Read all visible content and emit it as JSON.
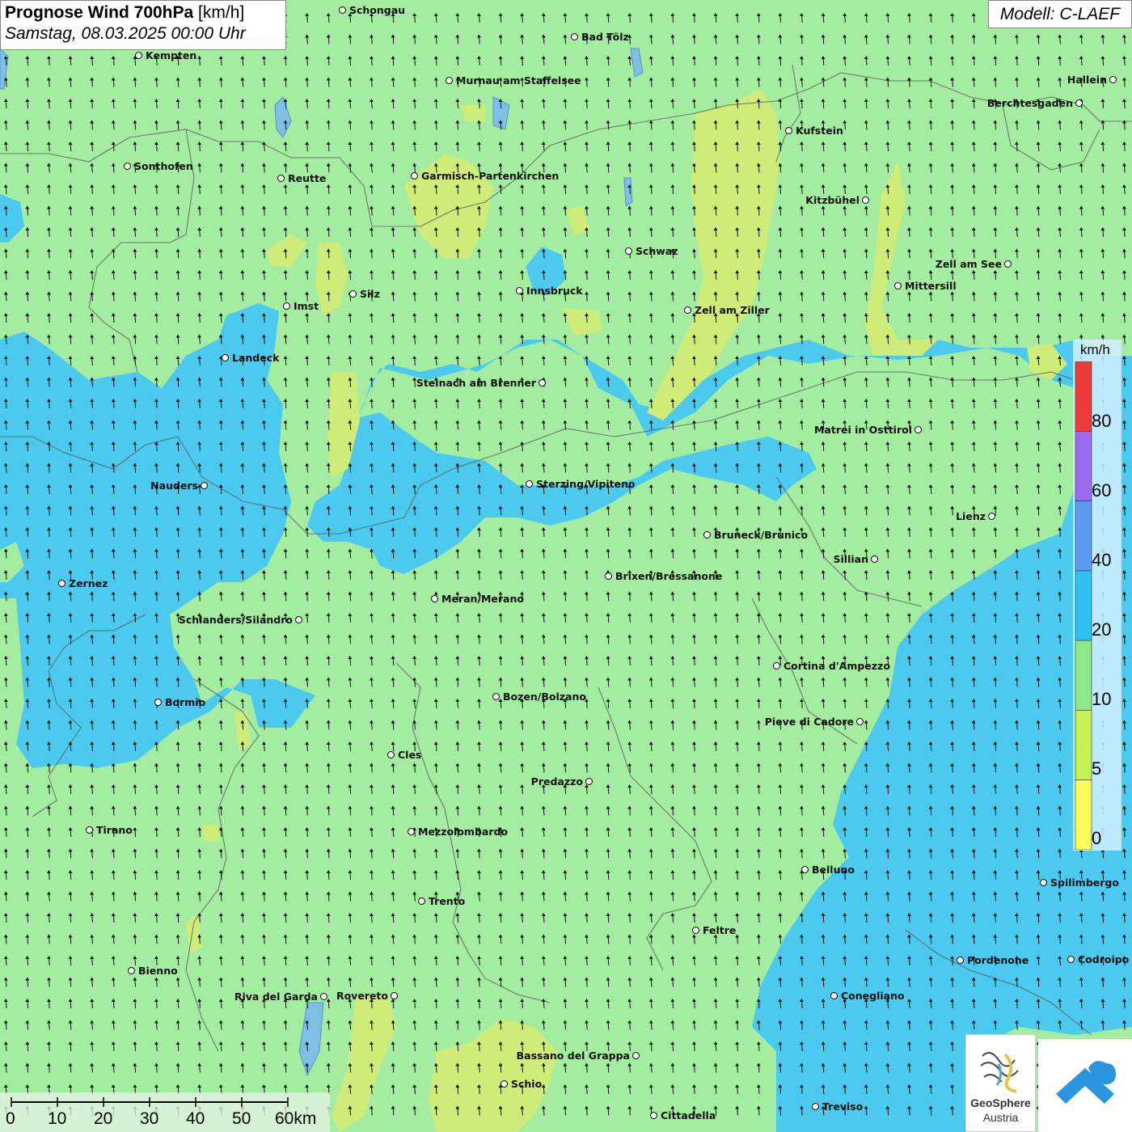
{
  "title": {
    "main": "Prognose Wind 700hPa",
    "unit": "[km/h]",
    "datetime": "Samstag, 08.03.2025 00:00 Uhr"
  },
  "model": "Modell: C-LAEF",
  "legend": {
    "unit": "km/h",
    "labels": [
      "80",
      "60",
      "40",
      "20",
      "10",
      "5",
      "0"
    ],
    "colors": [
      "#f03b3b",
      "#9b6bf2",
      "#5b9cf2",
      "#2ec1f2",
      "#8ee88a",
      "#c6f253",
      "#fdfb5a"
    ]
  },
  "scale_bar": {
    "labels": [
      "0",
      "10",
      "20",
      "30",
      "40",
      "50",
      "60km"
    ]
  },
  "cities": [
    {
      "name": "Schongau"
    },
    {
      "name": "Bad Tölz"
    },
    {
      "name": "Kempten"
    },
    {
      "name": "Murnau am Staffelsee"
    },
    {
      "name": "Hallein"
    },
    {
      "name": "Berchtesgaden"
    },
    {
      "name": "Kufstein"
    },
    {
      "name": "Sonthofen"
    },
    {
      "name": "Reutte"
    },
    {
      "name": "Garmisch-Partenkirchen"
    },
    {
      "name": "Kitzbühel"
    },
    {
      "name": "Schwaz"
    },
    {
      "name": "Zell am See"
    },
    {
      "name": "Mittersill"
    },
    {
      "name": "Innsbruck"
    },
    {
      "name": "Silz"
    },
    {
      "name": "Imst"
    },
    {
      "name": "Zell am Ziller"
    },
    {
      "name": "Landeck"
    },
    {
      "name": "Steinach am Brenner"
    },
    {
      "name": "Matrei in Osttirol"
    },
    {
      "name": "Nauders"
    },
    {
      "name": "Sterzing/Vipiteno"
    },
    {
      "name": "Lienz"
    },
    {
      "name": "Bruneck/Brunico"
    },
    {
      "name": "Sillian"
    },
    {
      "name": "Zernez"
    },
    {
      "name": "Brixen/Bressanone"
    },
    {
      "name": "Meran/Merano"
    },
    {
      "name": "Schlanders/Silandro"
    },
    {
      "name": "Cortina d'Ampezzo"
    },
    {
      "name": "Bozen/Bolzano"
    },
    {
      "name": "Bormio"
    },
    {
      "name": "Pieve di Cadore"
    },
    {
      "name": "Cles"
    },
    {
      "name": "Predazzo"
    },
    {
      "name": "Tirano"
    },
    {
      "name": "Mezzolombardo"
    },
    {
      "name": "Belluno"
    },
    {
      "name": "Spilimbergo"
    },
    {
      "name": "Trento"
    },
    {
      "name": "Feltre"
    },
    {
      "name": "Pordenone"
    },
    {
      "name": "Codroipo"
    },
    {
      "name": "Bienno"
    },
    {
      "name": "Riva del Garda"
    },
    {
      "name": "Rovereto"
    },
    {
      "name": "Conegliano"
    },
    {
      "name": "Bassano del Grappa"
    },
    {
      "name": "Schio"
    },
    {
      "name": "Treviso"
    },
    {
      "name": "Cittadella"
    }
  ],
  "logos": {
    "geosphere_line1": "GeoSphere",
    "geosphere_line2": "Austria"
  }
}
